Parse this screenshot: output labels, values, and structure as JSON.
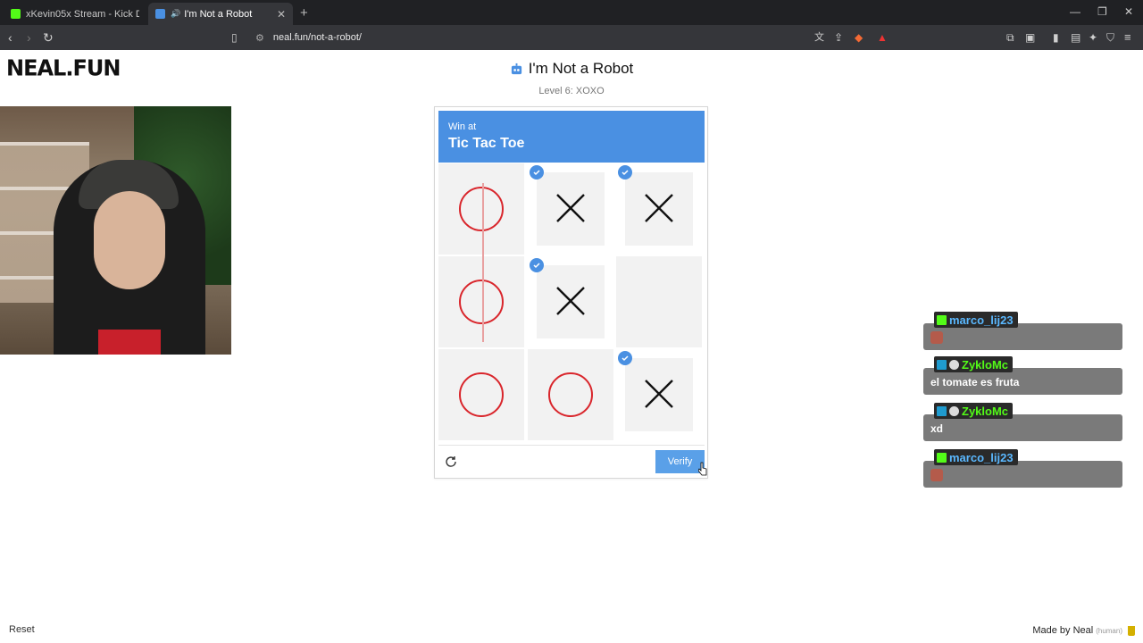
{
  "browser": {
    "tabs": [
      {
        "label": "xKevin05x Stream - Kick Dashboa",
        "active": false
      },
      {
        "label": "I'm Not a Robot",
        "active": true
      }
    ],
    "url": "neal.fun/not-a-robot/"
  },
  "page": {
    "logo": "NEAL.FUN",
    "title": "I'm Not a Robot",
    "subtitle": "Level 6: XOXO",
    "captcha": {
      "prompt_small": "Win at",
      "prompt_big": "Tic Tac Toe",
      "cells": [
        {
          "mark": "O",
          "checked": false
        },
        {
          "mark": "X",
          "checked": true
        },
        {
          "mark": "X",
          "checked": true
        },
        {
          "mark": "O",
          "checked": false
        },
        {
          "mark": "X",
          "checked": true
        },
        {
          "mark": "",
          "checked": false
        },
        {
          "mark": "O",
          "checked": false
        },
        {
          "mark": "O",
          "checked": false
        },
        {
          "mark": "X",
          "checked": true
        }
      ],
      "verify_label": "Verify"
    },
    "reset_label": "Reset",
    "made_by": "Made by Neal",
    "made_by_note": "(human)"
  },
  "chat": [
    {
      "user": "marco_lij23",
      "color": "#5ab8ff",
      "text": "",
      "emote": true
    },
    {
      "user": "ZykloMc",
      "color": "#53fc18",
      "text": "el tomate es fruta",
      "emote": false
    },
    {
      "user": "ZykloMc",
      "color": "#53fc18",
      "text": "xd",
      "emote": false
    },
    {
      "user": "marco_lij23",
      "color": "#5ab8ff",
      "text": "",
      "emote": true
    }
  ],
  "colors": {
    "accent": "#4a90e2",
    "o_mark": "#d9262c",
    "x_mark": "#111111"
  }
}
